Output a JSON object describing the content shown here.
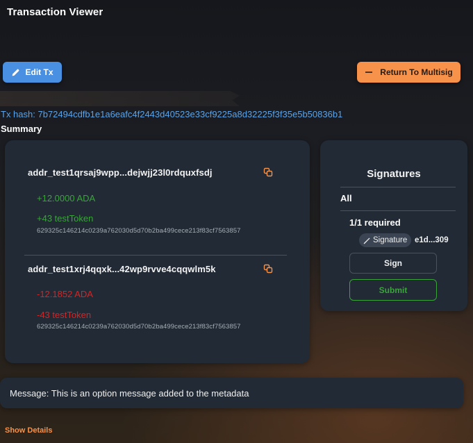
{
  "header": {
    "title": "Transaction Viewer"
  },
  "toolbar": {
    "edit_label": "Edit Tx",
    "return_label": "Return To Multisig"
  },
  "tx": {
    "hash_label": "Tx hash: 7b72494cdfb1e1a6eafc4f2443d40523e33cf9225a8d32225f3f35e5b50836b1",
    "summary_label": "Summary"
  },
  "summary": {
    "entries": [
      {
        "address": "addr_test1qrsaj9wpp...dejwjj23l0rdquxfsdj",
        "ada": "+12.0000 ADA",
        "token": "+43 testToken",
        "policy": "629325c146214c0239a762030d5d70b2ba499cece213f83cf7563857"
      },
      {
        "address": "addr_test1xrj4qqxk...42wp9rvve4cqqwlm5k",
        "ada": "-12.1852 ADA",
        "token": "-43 testToken",
        "policy": "629325c146214c0239a762030d5d70b2ba499cece213f83cf7563857"
      }
    ]
  },
  "signatures": {
    "title": "Signatures",
    "group": "All",
    "required": "1/1 required",
    "badge_label": "Signature",
    "key": "e1d...309",
    "sign_label": "Sign",
    "submit_label": "Submit"
  },
  "message": {
    "text": "Message: This is an option message added to the metadata"
  },
  "footer": {
    "show_details": "Show Details"
  },
  "colors": {
    "edit_button": "#4a90e2",
    "return_button": "#f6924a",
    "link": "#5ba3e8",
    "positive": "#3aa53a",
    "negative": "#d32626",
    "card": "#212a35"
  },
  "icons": {
    "edit": "pencil-icon",
    "return": "minus-icon",
    "copy": "copy-icon",
    "signature": "pen-icon"
  }
}
